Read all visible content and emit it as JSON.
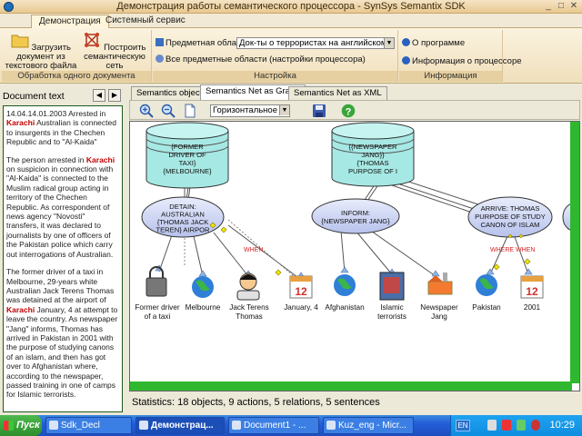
{
  "window": {
    "title": "Демонстрация работы семантического процессора - SynSys Semantix SDK"
  },
  "ribbon_tabs": [
    "Демонстрация",
    "Системный сервис"
  ],
  "ribbon": {
    "group1": {
      "label": "Обработка одного документа",
      "load_btn": "Загрузить документ из текстового файла",
      "build_btn": "Построить семантическую сеть"
    },
    "group2": {
      "label": "Настройка",
      "domain_label": "Предметная область",
      "domain_value": "Док-ты о террористах на английском",
      "all_domains": "Все предметные области (настройки процессора)"
    },
    "group3": {
      "label": "Информация",
      "about": "О программе",
      "proc_info": "Информация о процессоре"
    }
  },
  "left": {
    "header": "Document text",
    "paragraphs": [
      [
        {
          "t": "14.04.14.01.2003 Arrested in "
        },
        {
          "t": "Karachi",
          "k": true
        },
        {
          "t": " Australian is connected to insurgents in the Chechen Republic and to \"Al-Kaida\""
        }
      ],
      [
        {
          "t": "The person arrested in "
        },
        {
          "t": "Karachi",
          "k": true
        },
        {
          "t": " on suspicion in connection with \"Al-Kaida\" is connected to the Muslim radical group acting in territory of the Chechen Republic. As correspondent of news agency \"Novosti\" transfers, it was declared to journalists by one of officers of the Pakistan police which carry out interrogations of Australian."
        }
      ],
      [
        {
          "t": "The former driver of a taxi in Melbourne, 29-years white Australian Jack Terens Thomas was detained at the airport of "
        },
        {
          "t": "Karachi",
          "k": true
        },
        {
          "t": " January, 4 at attempt to leave the country. As newspaper \"Jang\" informs, Thomas has arrived in Pakistan in 2001 with the purpose of studying canons of an islam, and then has got over to Afghanistan where, according to the newspaper, passed training in one of camps for Islamic terrorists."
        }
      ]
    ]
  },
  "view_tabs": [
    "Semantics objects",
    "Semantics Net as Graph",
    "Semantics Net as XML"
  ],
  "toolbar": {
    "layout_combo": "Горизонтальное р..."
  },
  "graph": {
    "objects": [
      {
        "lines": [
          "{FORMER",
          "DRIVER OF",
          "TAXI}",
          "{MELBOURNE}"
        ]
      },
      {
        "lines": [
          "{{NEWSPAPER",
          "JANG}}",
          "{THOMAS",
          "PURPOSE OF I"
        ]
      }
    ],
    "actions": [
      {
        "lines": [
          "DETAIN:",
          "AUSTRALIAN",
          "{THOMAS JACK",
          "TEREN} AIRPOR"
        ]
      },
      {
        "lines": [
          "INFORM:",
          "{NEWSPAPER JANG}"
        ]
      },
      {
        "lines": [
          "ARRIVE: THOMAS",
          "PURPOSE OF STUDY",
          "CANON OF ISLAM"
        ]
      }
    ],
    "relations": [
      "WHEN",
      "WHERE WHEN"
    ],
    "entities": [
      {
        "lines": [
          "Former driver",
          "of a taxi"
        ]
      },
      {
        "lines": [
          "Melbourne"
        ]
      },
      {
        "lines": [
          "Jack Terens",
          "Thomas"
        ]
      },
      {
        "lines": [
          "January, 4"
        ]
      },
      {
        "lines": [
          "Afghanistan"
        ]
      },
      {
        "lines": [
          "Islamic",
          "terrorists"
        ]
      },
      {
        "lines": [
          "Newspaper",
          "Jang"
        ]
      },
      {
        "lines": [
          "Pakistan"
        ]
      },
      {
        "lines": [
          "2001"
        ]
      }
    ],
    "calendar_num": "12"
  },
  "status": {
    "stats": "Statistics: 18 objects, 9 actions, 5 relations, 5 sentences"
  },
  "taskbar": {
    "start": "Пуск",
    "tasks": [
      "Sdk_Decl",
      "Демонстрац...",
      "Document1 - ...",
      "Kuz_eng - Micr..."
    ],
    "lang": "EN",
    "clock": "10:29"
  }
}
